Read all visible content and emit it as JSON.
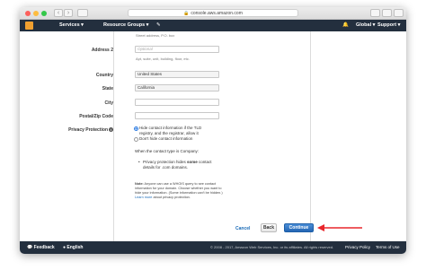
{
  "browser": {
    "url": "console.aws.amazon.com"
  },
  "aws_nav": {
    "services": "Services ▾",
    "resource_groups": "Resource Groups ▾",
    "pin": "✎",
    "bell": "🔔",
    "global": "Global ▾",
    "support": "Support ▾"
  },
  "form": {
    "address1_hint": "Street address, P.O. box",
    "address2_label": "Address 2",
    "address2_placeholder": "Optional",
    "address2_hint": "Apt, suite, unit, building, floor, etc.",
    "country_label": "Country",
    "country_value": "United States",
    "state_label": "State",
    "state_value": "California",
    "city_label": "City",
    "city_value": "",
    "zip_label": "Postal/Zip Code",
    "zip_value": "",
    "privacy_label": "Privacy Protection",
    "privacy_option_hide_line1": "Hide contact information if the TLD",
    "privacy_option_hide_line2": "registry, and the registrar, allow it",
    "privacy_option_dont_hide": "Don't hide contact information",
    "company_text": "When the contact type is Company:",
    "bullet_pre": "Privacy protection hides ",
    "bullet_bold": "some",
    "bullet_post": " contact",
    "bullet_line2": "details for .com domains.",
    "note_bold": "Note:",
    "note_text1": " Anyone can use a WHOIS query to see contact information for your domain. Choose whether you want to hide your information. (Some information can't be hidden.) ",
    "note_link": "Learn more",
    "note_text2": " about privacy protection."
  },
  "actions": {
    "cancel": "Cancel",
    "back": "Back",
    "continue": "Continue"
  },
  "footer": {
    "feedback": "Feedback",
    "english": "English",
    "copyright": "© 2008 - 2017, Amazon Web Services, Inc. or its affiliates. All rights reserved.",
    "privacy": "Privacy Policy",
    "terms": "Terms of Use"
  },
  "colors": {
    "aws_nav_bg": "#232f3e",
    "primary_button": "#2466b4",
    "annotation_arrow": "#e8262b"
  }
}
